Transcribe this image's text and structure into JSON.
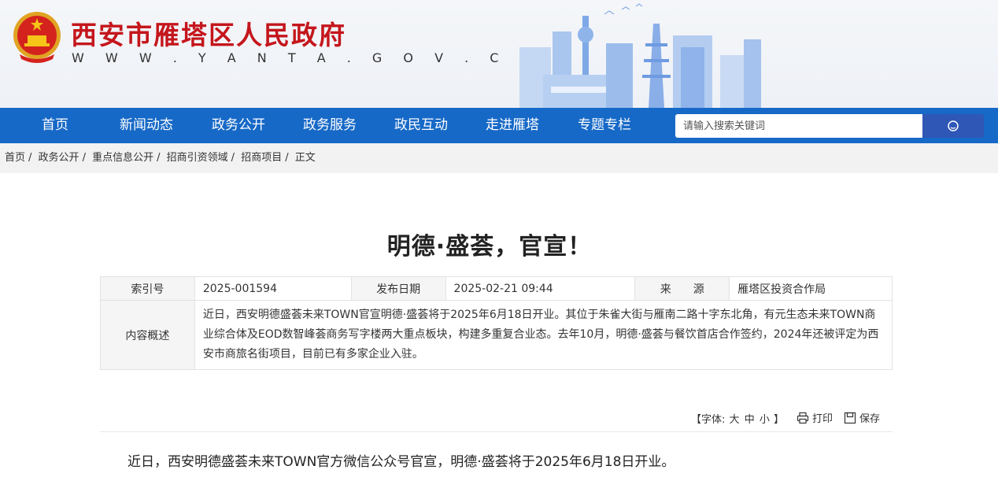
{
  "header": {
    "site_title": "西安市雁塔区人民政府",
    "site_url": "W W W . Y A N T A . G O V . C N"
  },
  "nav": {
    "items": [
      {
        "label": "首页"
      },
      {
        "label": "新闻动态"
      },
      {
        "label": "政务公开"
      },
      {
        "label": "政务服务"
      },
      {
        "label": "政民互动"
      },
      {
        "label": "走进雁塔"
      },
      {
        "label": "专题专栏"
      }
    ],
    "search_placeholder": "请输入搜索关键词"
  },
  "breadcrumb": [
    "首页",
    "政务公开",
    "重点信息公开",
    "招商引资领域",
    "招商项目",
    "正文"
  ],
  "article": {
    "title": "明德·盛荟，官宣！",
    "meta": {
      "index_label": "索引号",
      "index_value": "2025-001594",
      "date_label": "发布日期",
      "date_value": "2025-02-21 09:44",
      "source_label": "来　　源",
      "source_value": "雁塔区投资合作局",
      "summary_label": "内容概述",
      "summary_value": "近日，西安明德盛荟未来TOWN官宣明德·盛荟将于2025年6月18日开业。其位于朱雀大街与雁南二路十字东北角，有元生态未来TOWN商业综合体及EOD数智峰荟商务写字楼两大重点板块，构建多重复合业态。去年10月，明德·盛荟与餐饮首店合作签约，2024年还被评定为西安市商旅名街项目，目前已有多家企业入驻。"
    },
    "tools": {
      "font_prefix": "【字体:",
      "font_large": "大",
      "font_medium": "中",
      "font_small": "小",
      "font_suffix": "】",
      "print_label": "打印",
      "save_label": "保存"
    },
    "first_paragraph": "近日，西安明德盛荟未来TOWN官方微信公众号官宣，明德·盛荟将于2025年6月18日开业。"
  },
  "colors": {
    "nav_bg": "#1769c7",
    "title_red": "#c4161c",
    "search_btn": "#2f57b6"
  },
  "icons": [
    "national-emblem-icon",
    "skyline-illustration",
    "search-icon",
    "print-icon",
    "save-icon"
  ]
}
